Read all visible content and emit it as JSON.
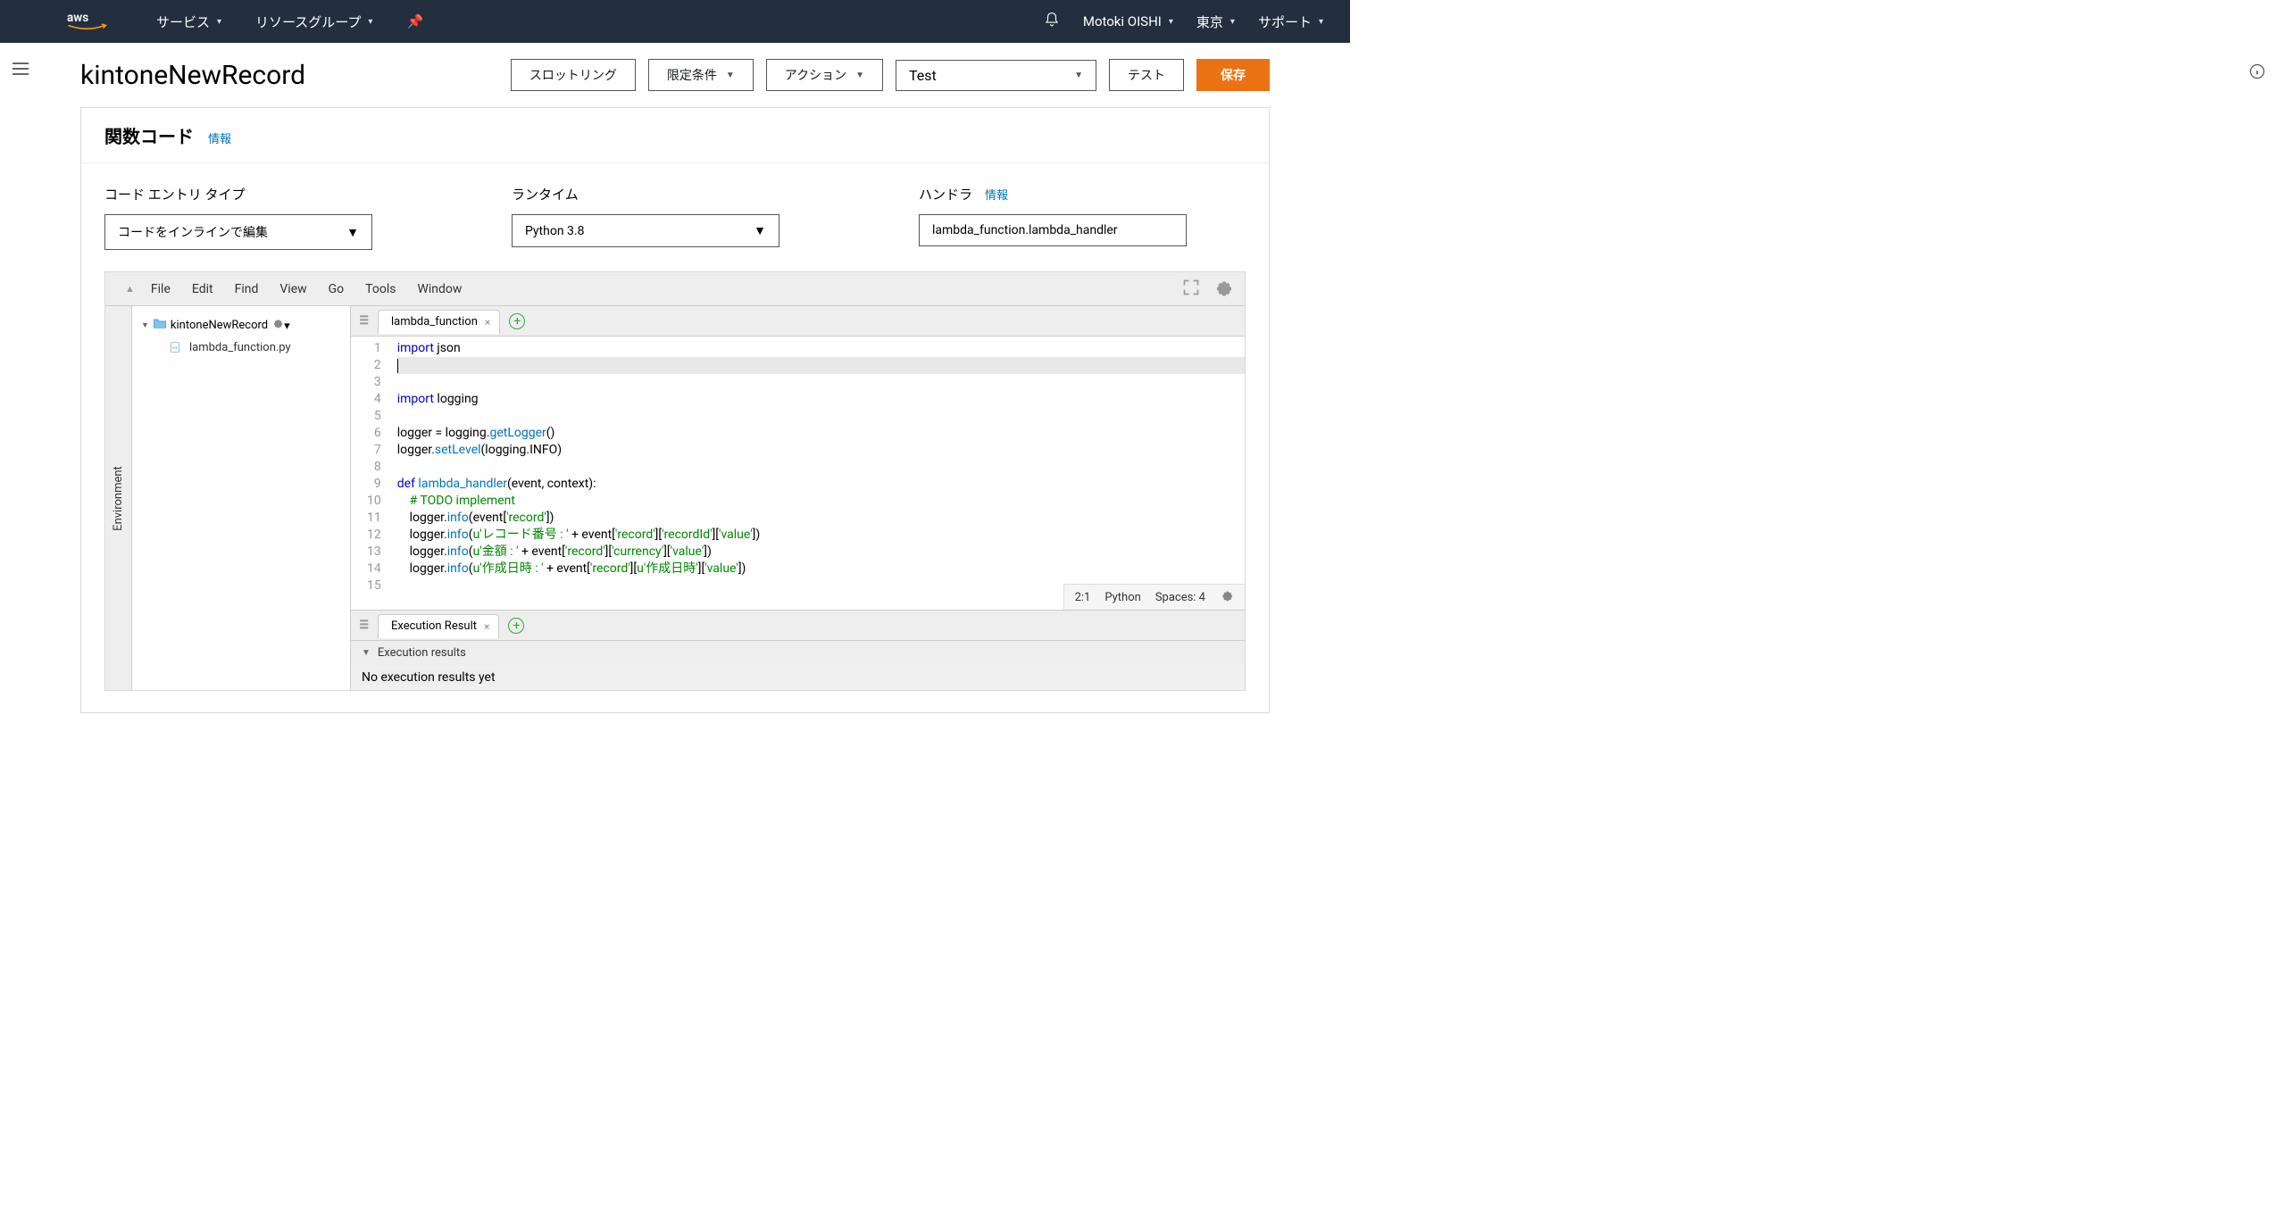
{
  "topnav": {
    "services": "サービス",
    "resource_groups": "リソースグループ",
    "user": "Motoki OISHI",
    "region": "東京",
    "support": "サポート"
  },
  "page": {
    "title": "kintoneNewRecord"
  },
  "toolbar": {
    "throttling": "スロットリング",
    "qualifier": "限定条件",
    "actions": "アクション",
    "test_select": "Test",
    "test_btn": "テスト",
    "save": "保存"
  },
  "panel": {
    "title": "関数コード",
    "info_link": "情報"
  },
  "config": {
    "entry_label": "コード エントリ タイプ",
    "entry_value": "コードをインラインで編集",
    "runtime_label": "ランタイム",
    "runtime_value": "Python 3.8",
    "handler_label": "ハンドラ",
    "handler_info": "情報",
    "handler_value": "lambda_function.lambda_handler"
  },
  "ide": {
    "menu": [
      "File",
      "Edit",
      "Find",
      "View",
      "Go",
      "Tools",
      "Window"
    ],
    "sidebar_label": "Environment",
    "tree": {
      "root": "kintoneNewRecord",
      "file": "lambda_function.py"
    },
    "tab": "lambda_function",
    "code_lines": [
      {
        "n": 1,
        "tokens": [
          {
            "t": "import",
            "c": "kw"
          },
          {
            "t": " json",
            "c": ""
          }
        ]
      },
      {
        "n": 2,
        "tokens": [],
        "active": true
      },
      {
        "n": 3,
        "tokens": []
      },
      {
        "n": 4,
        "tokens": [
          {
            "t": "import",
            "c": "kw"
          },
          {
            "t": " logging",
            "c": ""
          }
        ]
      },
      {
        "n": 5,
        "tokens": []
      },
      {
        "n": 6,
        "tokens": [
          {
            "t": "logger = logging.",
            "c": ""
          },
          {
            "t": "getLogger",
            "c": "fn"
          },
          {
            "t": "()",
            "c": ""
          }
        ]
      },
      {
        "n": 7,
        "tokens": [
          {
            "t": "logger.",
            "c": ""
          },
          {
            "t": "setLevel",
            "c": "fn"
          },
          {
            "t": "(logging.INFO)",
            "c": ""
          }
        ]
      },
      {
        "n": 8,
        "tokens": []
      },
      {
        "n": 9,
        "tokens": [
          {
            "t": "def",
            "c": "kw"
          },
          {
            "t": " ",
            "c": ""
          },
          {
            "t": "lambda_handler",
            "c": "fn"
          },
          {
            "t": "(event, context):",
            "c": ""
          }
        ]
      },
      {
        "n": 10,
        "tokens": [
          {
            "t": "    ",
            "c": ""
          },
          {
            "t": "# TODO implement",
            "c": "cm"
          }
        ]
      },
      {
        "n": 11,
        "tokens": [
          {
            "t": "    logger.",
            "c": ""
          },
          {
            "t": "info",
            "c": "fn"
          },
          {
            "t": "(event[",
            "c": ""
          },
          {
            "t": "'record'",
            "c": "str"
          },
          {
            "t": "])",
            "c": ""
          }
        ]
      },
      {
        "n": 12,
        "tokens": [
          {
            "t": "    logger.",
            "c": ""
          },
          {
            "t": "info",
            "c": "fn"
          },
          {
            "t": "(",
            "c": ""
          },
          {
            "t": "u'レコード番号 : '",
            "c": "str"
          },
          {
            "t": " + event[",
            "c": ""
          },
          {
            "t": "'record'",
            "c": "str"
          },
          {
            "t": "][",
            "c": ""
          },
          {
            "t": "'recordId'",
            "c": "str"
          },
          {
            "t": "][",
            "c": ""
          },
          {
            "t": "'value'",
            "c": "str"
          },
          {
            "t": "])",
            "c": ""
          }
        ]
      },
      {
        "n": 13,
        "tokens": [
          {
            "t": "    logger.",
            "c": ""
          },
          {
            "t": "info",
            "c": "fn"
          },
          {
            "t": "(",
            "c": ""
          },
          {
            "t": "u'金額 : '",
            "c": "str"
          },
          {
            "t": " + event[",
            "c": ""
          },
          {
            "t": "'record'",
            "c": "str"
          },
          {
            "t": "][",
            "c": ""
          },
          {
            "t": "'currency'",
            "c": "str"
          },
          {
            "t": "][",
            "c": ""
          },
          {
            "t": "'value'",
            "c": "str"
          },
          {
            "t": "])",
            "c": ""
          }
        ]
      },
      {
        "n": 14,
        "tokens": [
          {
            "t": "    logger.",
            "c": ""
          },
          {
            "t": "info",
            "c": "fn"
          },
          {
            "t": "(",
            "c": ""
          },
          {
            "t": "u'作成日時 : '",
            "c": "str"
          },
          {
            "t": " + event[",
            "c": ""
          },
          {
            "t": "'record'",
            "c": "str"
          },
          {
            "t": "][",
            "c": ""
          },
          {
            "t": "u'作成日時'",
            "c": "str"
          },
          {
            "t": "][",
            "c": ""
          },
          {
            "t": "'value'",
            "c": "str"
          },
          {
            "t": "])",
            "c": ""
          }
        ]
      },
      {
        "n": 15,
        "tokens": []
      }
    ],
    "status": {
      "pos": "2:1",
      "lang": "Python",
      "spaces": "Spaces: 4"
    },
    "exec": {
      "tab": "Execution Result",
      "header": "Execution results",
      "body": "No execution results yet"
    }
  }
}
